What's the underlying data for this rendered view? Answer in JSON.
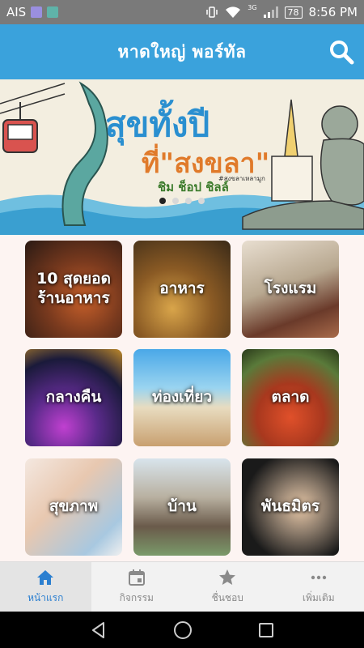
{
  "status_bar": {
    "carrier": "AIS",
    "network": "3G",
    "battery": "78",
    "time": "8:56 PM"
  },
  "header": {
    "title": "หาดใหญ่ พอร์ทัล",
    "accent": "#3aa2dc"
  },
  "banner": {
    "headline_1": "สุขทั้งปี",
    "headline_2": "ที่\"สงขลา\"",
    "tagline": "ชิม ช็อป ชิลล์",
    "hashtag": "#สงขลาเหลามูก",
    "slide_count": 4,
    "active_slide": 1
  },
  "categories": [
    {
      "label": "10 สุดยอดร้านอาหาร",
      "icon": "restaurant-photo"
    },
    {
      "label": "อาหาร",
      "icon": "food-photo"
    },
    {
      "label": "โรงแรม",
      "icon": "hotel-photo"
    },
    {
      "label": "กลางคืน",
      "icon": "nightlife-photo"
    },
    {
      "label": "ท่องเที่ยว",
      "icon": "travel-photo"
    },
    {
      "label": "ตลาด",
      "icon": "market-photo"
    },
    {
      "label": "สุขภาพ",
      "icon": "health-photo"
    },
    {
      "label": "บ้าน",
      "icon": "house-photo"
    },
    {
      "label": "พันธมิตร",
      "icon": "partner-photo"
    }
  ],
  "bottom_nav": [
    {
      "label": "หน้าแรก",
      "icon": "home-icon",
      "active": true
    },
    {
      "label": "กิจกรรม",
      "icon": "calendar-icon",
      "active": false
    },
    {
      "label": "ชื่นชอบ",
      "icon": "star-icon",
      "active": false
    },
    {
      "label": "เพิ่มเติม",
      "icon": "more-icon",
      "active": false
    }
  ]
}
